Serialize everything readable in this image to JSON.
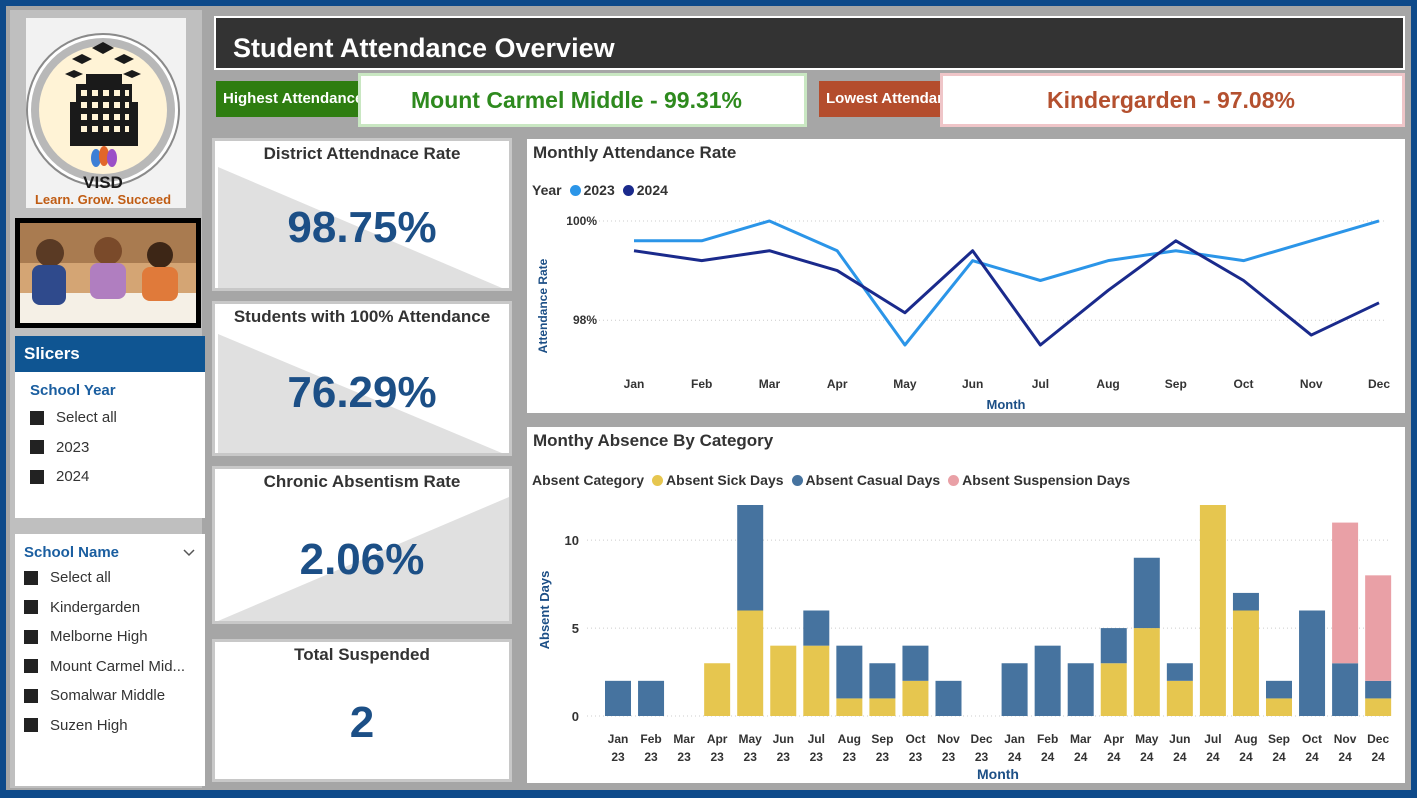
{
  "title": "Student Attendance Overview",
  "logo": {
    "name": "VISD",
    "tagline": "Learn. Grow. Succeed"
  },
  "highlights": {
    "highest_label": "Highest Attendance",
    "highest_value": "Mount Carmel Middle - 99.31%",
    "lowest_label": "Lowest Attendance",
    "lowest_value": "Kindergarden - 97.08%"
  },
  "slicers": {
    "header": "Slicers",
    "school_year": {
      "title": "School Year",
      "items": [
        "Select all",
        "2023",
        "2024"
      ]
    },
    "school_name": {
      "title": "School Name",
      "items": [
        "Select all",
        "Kindergarden",
        "Melborne High",
        "Mount Carmel Mid...",
        "Somalwar Middle",
        "Suzen High"
      ]
    }
  },
  "kpis": {
    "district": {
      "title": "District Attendnace Rate",
      "value": "98.75%"
    },
    "students_100": {
      "title": "Students with 100% Attendance",
      "value": "76.29%"
    },
    "chronic": {
      "title": "Chronic Absentism Rate",
      "value": "2.06%"
    },
    "suspended": {
      "title": "Total Suspended",
      "value": "2"
    }
  },
  "colors": {
    "highest": "#2e7d10",
    "highest_text": "#2e8a1e",
    "lowest": "#b44d2d",
    "lowest_text": "#b4502f",
    "line_2023": "#2b95e8",
    "line_2024": "#1a2a8c",
    "sick": "#e6c64f",
    "casual": "#46739f",
    "suspension": "#e9a0a6",
    "kpi_value": "#1c4f86"
  },
  "chart_data": [
    {
      "type": "line",
      "title": "Monthly Attendance Rate",
      "legend_title": "Year",
      "xlabel": "Month",
      "ylabel": "Attendance Rate",
      "categories": [
        "Jan",
        "Feb",
        "Mar",
        "Apr",
        "May",
        "Jun",
        "Jul",
        "Aug",
        "Sep",
        "Oct",
        "Nov",
        "Dec"
      ],
      "y_ticks": [
        98,
        100
      ],
      "y_tick_labels": [
        "98%",
        "100%"
      ],
      "ylim": [
        97.5,
        100.1
      ],
      "series": [
        {
          "name": "2023",
          "values": [
            99.6,
            99.6,
            100.0,
            99.4,
            97.5,
            99.2,
            98.8,
            99.2,
            99.4,
            99.2,
            99.6,
            100.0
          ]
        },
        {
          "name": "2024",
          "values": [
            99.4,
            99.2,
            99.4,
            99.0,
            98.15,
            99.4,
            97.5,
            98.6,
            99.6,
            98.8,
            97.7,
            98.35
          ]
        }
      ]
    },
    {
      "type": "bar",
      "stacked": true,
      "title": "Monthy Absence By Category",
      "legend_title": "Absent Category",
      "xlabel": "Month",
      "ylabel": "Absent Days",
      "y_ticks": [
        0,
        5,
        10
      ],
      "ylim": [
        0,
        12
      ],
      "categories": [
        [
          "Jan",
          "23"
        ],
        [
          "Feb",
          "23"
        ],
        [
          "Mar",
          "23"
        ],
        [
          "Apr",
          "23"
        ],
        [
          "May",
          "23"
        ],
        [
          "Jun",
          "23"
        ],
        [
          "Jul",
          "23"
        ],
        [
          "Aug",
          "23"
        ],
        [
          "Sep",
          "23"
        ],
        [
          "Oct",
          "23"
        ],
        [
          "Nov",
          "23"
        ],
        [
          "Dec",
          "23"
        ],
        [
          "Jan",
          "24"
        ],
        [
          "Feb",
          "24"
        ],
        [
          "Mar",
          "24"
        ],
        [
          "Apr",
          "24"
        ],
        [
          "May",
          "24"
        ],
        [
          "Jun",
          "24"
        ],
        [
          "Jul",
          "24"
        ],
        [
          "Aug",
          "24"
        ],
        [
          "Sep",
          "24"
        ],
        [
          "Oct",
          "24"
        ],
        [
          "Nov",
          "24"
        ],
        [
          "Dec",
          "24"
        ]
      ],
      "series": [
        {
          "name": "Absent Sick Days",
          "values": [
            0,
            0,
            0,
            3,
            6,
            4,
            4,
            1,
            1,
            2,
            0,
            0,
            0,
            0,
            0,
            3,
            5,
            2,
            12,
            6,
            1,
            0,
            0,
            1
          ]
        },
        {
          "name": "Absent Casual Days",
          "values": [
            2,
            2,
            0,
            0,
            6,
            0,
            2,
            3,
            2,
            2,
            2,
            0,
            3,
            4,
            3,
            2,
            4,
            1,
            0,
            1,
            1,
            6,
            3,
            1
          ]
        },
        {
          "name": "Absent Suspension Days",
          "values": [
            0,
            0,
            0,
            0,
            0,
            0,
            0,
            0,
            0,
            0,
            0,
            0,
            0,
            0,
            0,
            0,
            0,
            0,
            0,
            0,
            0,
            0,
            8,
            6
          ]
        }
      ]
    }
  ]
}
